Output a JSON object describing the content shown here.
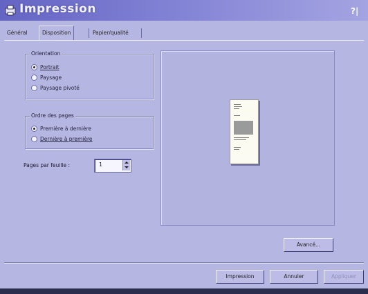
{
  "window": {
    "title": "Impression",
    "help_label": "?|"
  },
  "tabs": [
    {
      "label": "Général",
      "active": false
    },
    {
      "label": "Disposition",
      "active": true
    },
    {
      "label": "Papier/qualité",
      "active": false
    }
  ],
  "orientation": {
    "legend": "Orientation",
    "options": [
      {
        "label": "Portrait",
        "checked": true
      },
      {
        "label": "Paysage",
        "checked": false
      },
      {
        "label": "Paysage pivoté",
        "checked": false
      }
    ]
  },
  "page_order": {
    "legend": "Ordre des pages",
    "options": [
      {
        "label": "Première à dernière",
        "checked": true
      },
      {
        "label": "Dernière à première",
        "checked": false
      }
    ]
  },
  "pages_per_sheet": {
    "label": "Pages par feuille :",
    "value": "1"
  },
  "buttons": {
    "advanced": "Avancé...",
    "print": "Impression",
    "cancel": "Annuler",
    "apply": "Appliquer"
  },
  "colors": {
    "dialog_bg": "#b6b6e2",
    "titlebar_start": "#6464c4"
  }
}
